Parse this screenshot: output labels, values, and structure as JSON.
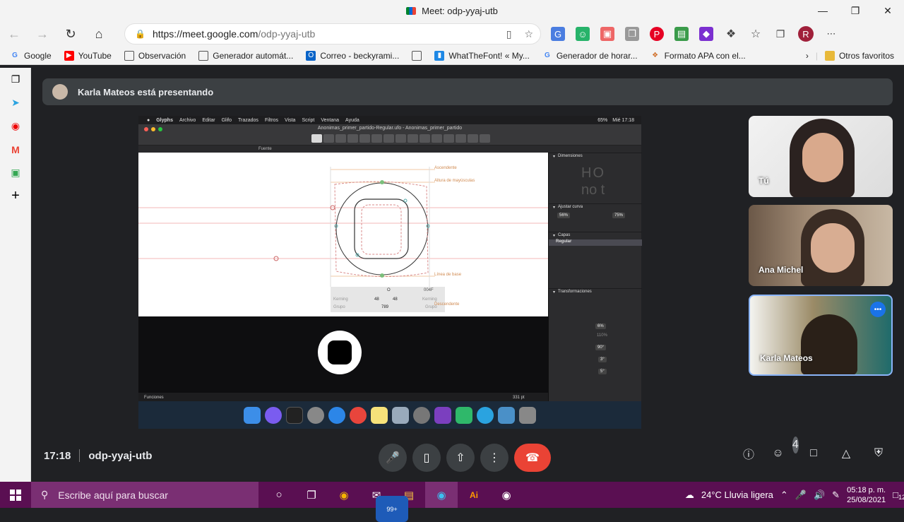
{
  "browser": {
    "window_title": "Meet: odp-yyaj-utb",
    "url_host": "https://meet.google.com",
    "url_path": "/odp-yyaj-utb",
    "bookmarks": [
      "Google",
      "YouTube",
      "Observación",
      "Generador automát...",
      "Correo - beckyrami...",
      "WhatTheFont! « My...",
      "Generador de horar...",
      "Formato APA con el..."
    ],
    "other_favorites": "Otros favoritos"
  },
  "meet": {
    "presenting_banner": "Karla Mateos está presentando",
    "time": "17:18",
    "meeting_code": "odp-yyaj-utb",
    "people_count": "4",
    "participants": [
      {
        "name": "Tú"
      },
      {
        "name": "Ana Michel"
      },
      {
        "name": "Karla Mateos"
      }
    ]
  },
  "shared_screen": {
    "menu": [
      "Glyphs",
      "Archivo",
      "Editar",
      "Glifo",
      "Trazados",
      "Filtros",
      "Vista",
      "Script",
      "Ventana",
      "Ayuda"
    ],
    "menu_right": [
      "65%",
      "Mié 17:18"
    ],
    "doc_title": "Anonimas_primer_partido-Regular.ufo - Anonimas_primer_partido",
    "tab_label": "Fuente",
    "guides": [
      "Ascendente",
      "Altura de mayúsculas",
      "Línea de base",
      "Descendente"
    ],
    "kerning": {
      "label_left": "Kerning",
      "val_left": "48",
      "val_right": "48",
      "label_right": "Kerning",
      "group_left": "Grupo",
      "width": "789",
      "group_right": "Grupo",
      "glyph": "O",
      "code": "004F"
    },
    "panel": {
      "dimensiones": "Dimensiones",
      "dim_preview_top": "HO",
      "dim_preview_bottom": "no  t",
      "ajustar_curva": "Ajustar curva",
      "curve_left": "56%",
      "curve_right": "75%",
      "capas": "Capas",
      "layer": "Regular",
      "transformaciones": "Transformaciones",
      "t_scale": "6%",
      "t_scale2": "110%",
      "t_rotate": "90°",
      "t_slant": "3°",
      "t_skew": "5°"
    },
    "bottom_left": "Funciones",
    "zoom": "331 pt"
  },
  "taskbar": {
    "search_placeholder": "Escribe aquí para buscar",
    "weather": "24°C  Lluvia ligera",
    "time": "05:18 p. m.",
    "date": "25/08/2021",
    "mail_badge": "99+",
    "notif_count": "12"
  }
}
